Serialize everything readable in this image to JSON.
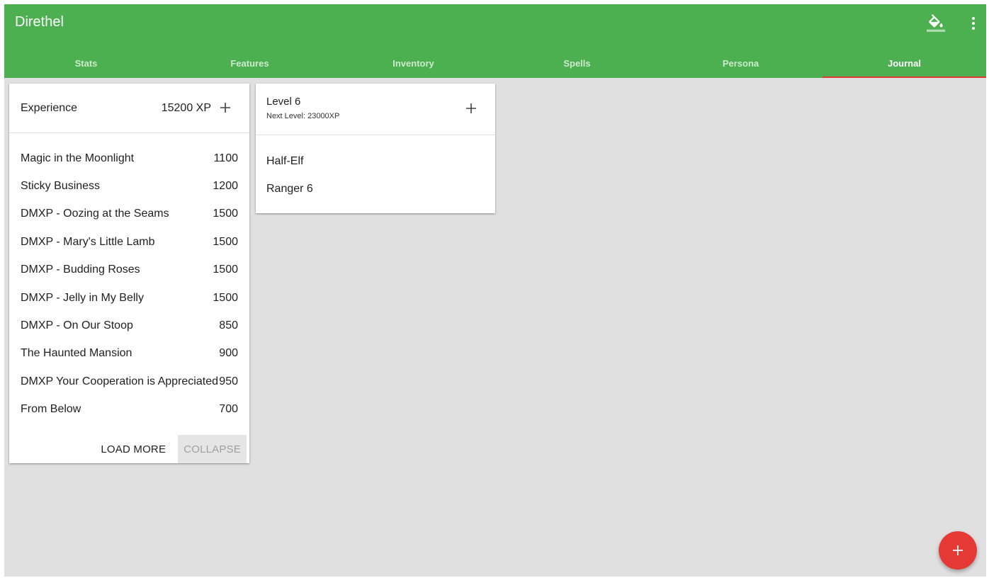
{
  "app": {
    "title": "Direthel"
  },
  "toolbar": {
    "paint_icon": "format-color-fill-icon",
    "menu_icon": "more-vert-icon"
  },
  "tabs": [
    {
      "label": "Stats"
    },
    {
      "label": "Features"
    },
    {
      "label": "Inventory"
    },
    {
      "label": "Spells"
    },
    {
      "label": "Persona"
    },
    {
      "label": "Journal",
      "active": true
    }
  ],
  "experience": {
    "label": "Experience",
    "total": "15200 XP",
    "entries": [
      {
        "name": "Magic in the Moonlight",
        "xp": "1100"
      },
      {
        "name": "Sticky Business",
        "xp": "1200"
      },
      {
        "name": "DMXP - Oozing at the Seams",
        "xp": "1500"
      },
      {
        "name": "DMXP - Mary's Little Lamb",
        "xp": "1500"
      },
      {
        "name": "DMXP - Budding Roses",
        "xp": "1500"
      },
      {
        "name": "DMXP - Jelly in My Belly",
        "xp": "1500"
      },
      {
        "name": "DMXP - On Our Stoop",
        "xp": "850"
      },
      {
        "name": "The Haunted Mansion",
        "xp": "900"
      },
      {
        "name": "DMXP Your Cooperation is Appreciated",
        "xp": "950"
      },
      {
        "name": "From Below",
        "xp": "700"
      }
    ],
    "load_more_label": "LOAD MORE",
    "collapse_label": "COLLAPSE"
  },
  "level": {
    "title": "Level 6",
    "next": "Next Level: 23000XP",
    "items": [
      {
        "label": "Half-Elf"
      },
      {
        "label": "Ranger 6"
      }
    ]
  },
  "colors": {
    "primary": "#4caf50",
    "accent": "#e53935",
    "background": "#e0e0e0"
  }
}
